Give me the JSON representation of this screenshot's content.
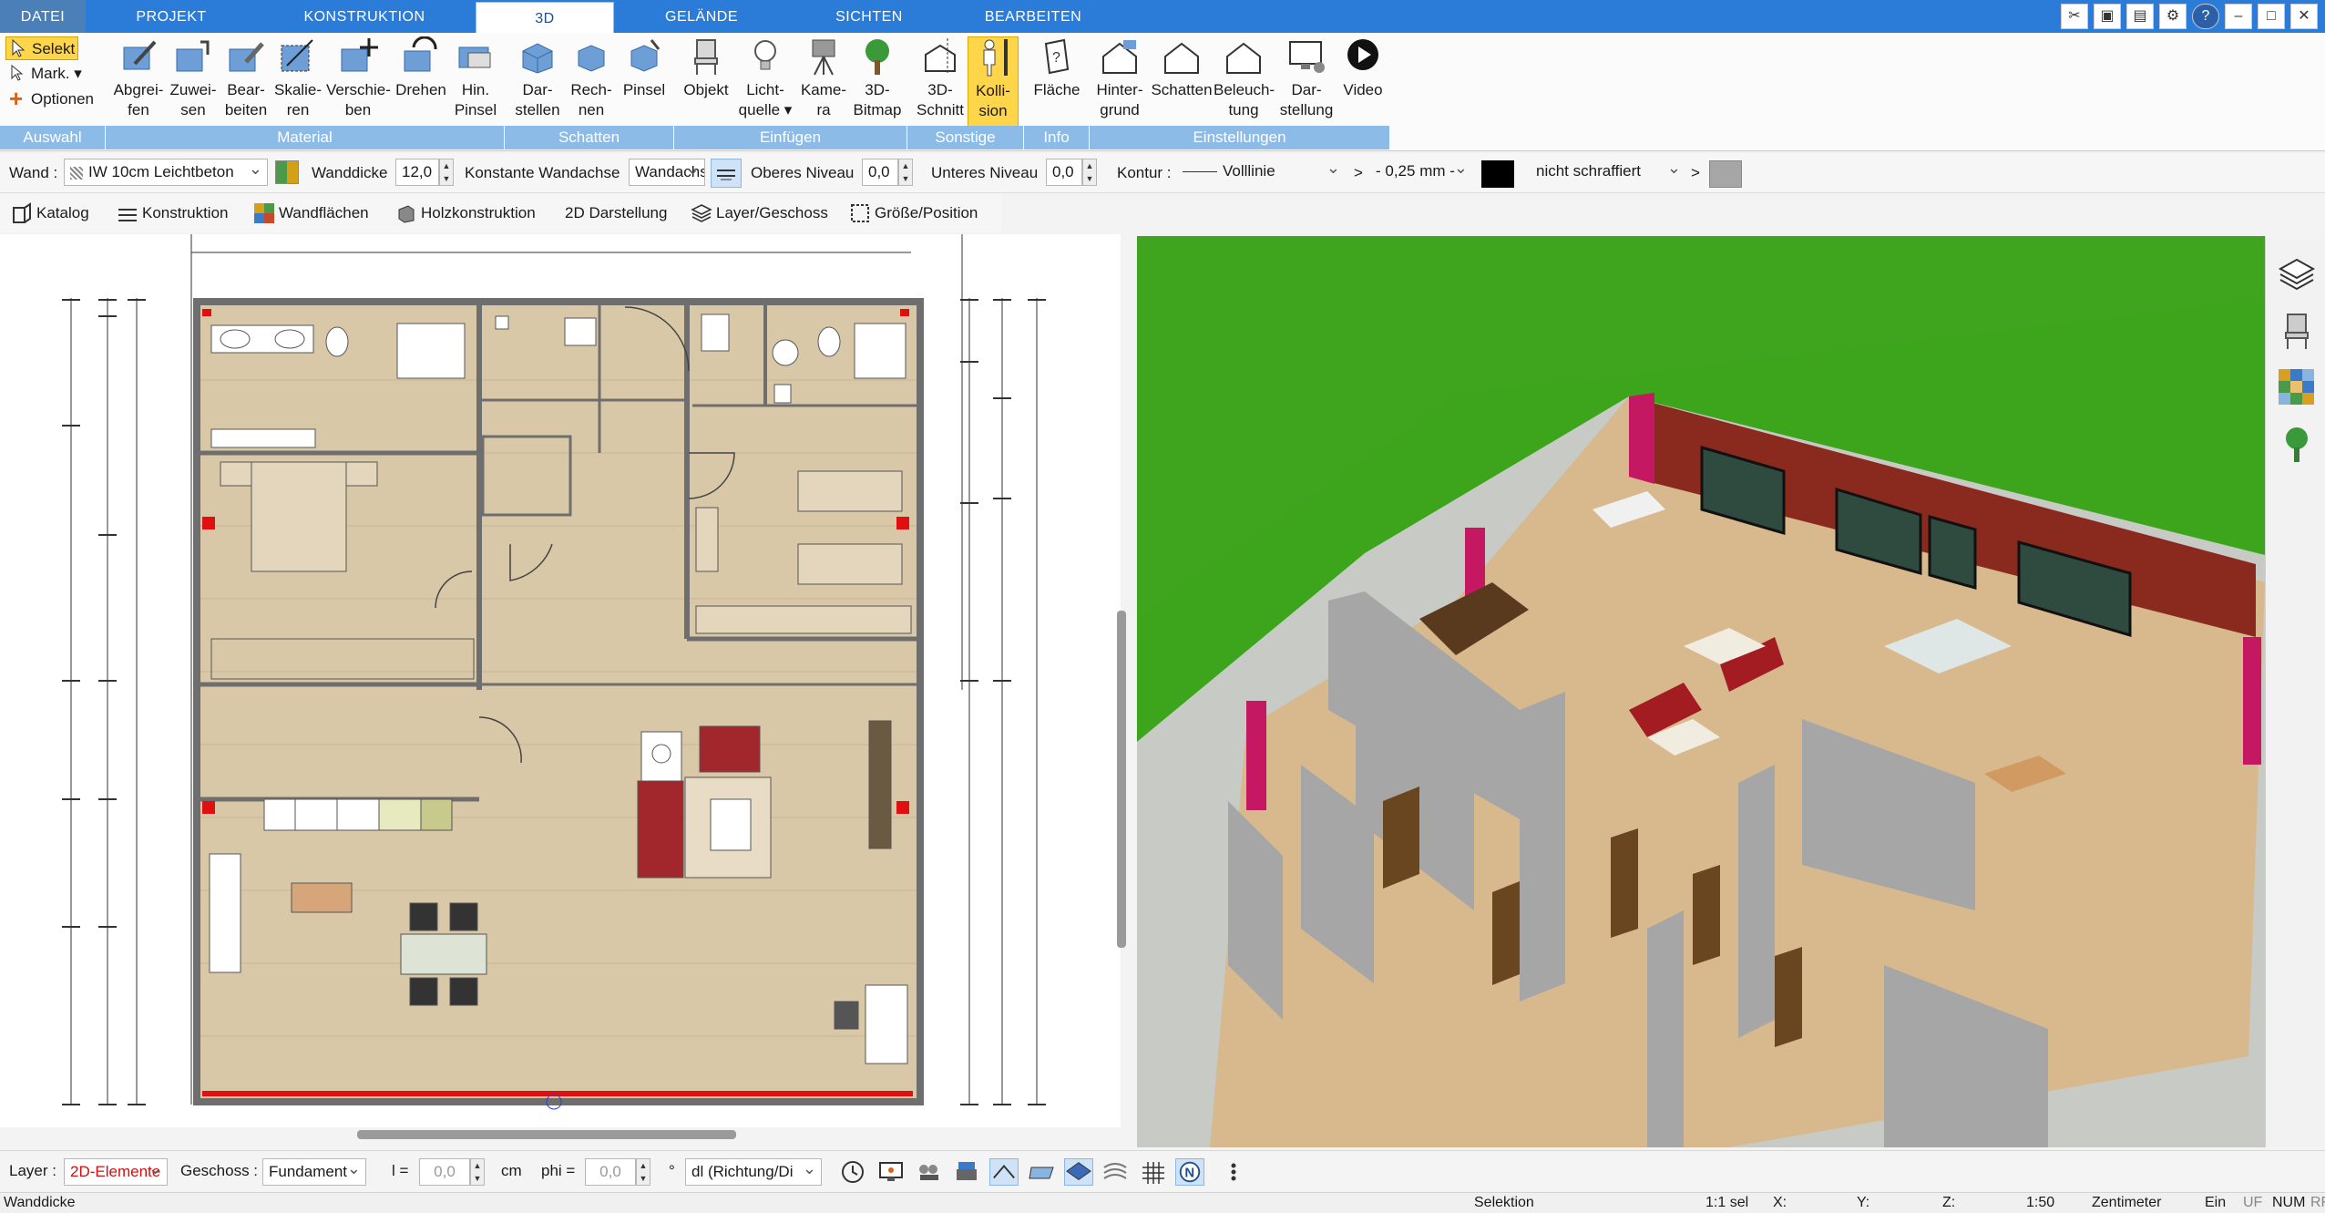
{
  "tabs": {
    "file": "DATEI",
    "items": [
      "PROJEKT",
      "KONSTRUKTION",
      "3D",
      "GELÄNDE",
      "SICHTEN",
      "BEARBEITEN"
    ]
  },
  "ribbon": {
    "selection": {
      "select": "Selekt",
      "mark": "Mark.",
      "options": "Optionen",
      "group": "Auswahl"
    },
    "material": {
      "group": "Material",
      "buttons": [
        {
          "l1": "Abgrei-",
          "l2": "fen",
          "icon": "pipette-icon"
        },
        {
          "l1": "Zuwei-",
          "l2": "sen",
          "icon": "assign-icon"
        },
        {
          "l1": "Bear-",
          "l2": "beiten",
          "icon": "edit-material-icon"
        },
        {
          "l1": "Skalie-",
          "l2": "ren",
          "icon": "scale-icon"
        },
        {
          "l1": "Verschie-",
          "l2": "ben",
          "icon": "move-icon"
        },
        {
          "l1": "Drehen",
          "l2": "",
          "icon": "rotate-icon"
        },
        {
          "l1": "Hin.",
          "l2": "Pinsel",
          "icon": "background-brush-icon"
        }
      ]
    },
    "schatten": {
      "group": "Schatten",
      "buttons": [
        {
          "l1": "Dar-",
          "l2": "stellen",
          "icon": "shadow-show-icon"
        },
        {
          "l1": "Rech-",
          "l2": "nen",
          "icon": "shadow-calc-icon"
        },
        {
          "l1": "Pinsel",
          "l2": "",
          "icon": "shadow-brush-icon"
        }
      ]
    },
    "einfuegen": {
      "group": "Einfügen",
      "buttons": [
        {
          "l1": "Objekt",
          "l2": "",
          "icon": "chair-icon"
        },
        {
          "l1": "Licht-",
          "l2": "quelle ▾",
          "icon": "lightbulb-icon"
        },
        {
          "l1": "Kame-",
          "l2": "ra",
          "icon": "camera-icon"
        },
        {
          "l1": "3D-",
          "l2": "Bitmap",
          "icon": "tree-icon"
        }
      ]
    },
    "sonstige": {
      "group": "Sonstige",
      "buttons": [
        {
          "l1": "3D-",
          "l2": "Schnitt",
          "icon": "section-icon"
        },
        {
          "l1": "Kolli-",
          "l2": "sion",
          "icon": "collision-icon"
        }
      ]
    },
    "info": {
      "group": "Info",
      "buttons": [
        {
          "l1": "Fläche",
          "l2": "",
          "icon": "area-icon"
        }
      ]
    },
    "einstellungen": {
      "group": "Einstellungen",
      "buttons": [
        {
          "l1": "Hinter-",
          "l2": "grund",
          "icon": "background-icon"
        },
        {
          "l1": "Schatten",
          "l2": "",
          "icon": "house-shadow-icon"
        },
        {
          "l1": "Beleuch-",
          "l2": "tung",
          "icon": "house-light-icon"
        },
        {
          "l1": "Dar-",
          "l2": "stellung",
          "icon": "display-icon"
        },
        {
          "l1": "Video",
          "l2": "",
          "icon": "play-icon"
        }
      ]
    }
  },
  "props": {
    "wall_label": "Wand :",
    "wall_type": "IW 10cm Leichtbeton",
    "thickness_label": "Wanddicke",
    "thickness": "12,0",
    "const_label": "Konstante Wandachse",
    "const_value": "Wandachse",
    "upper_label": "Oberes Niveau",
    "upper": "0,0",
    "lower_label": "Unteres Niveau",
    "lower": "0,0",
    "contour_label": "Kontur :",
    "line_style": "Volllinie",
    "gt1": ">",
    "width": "- 0,25 mm -",
    "hatch": "nicht schraffiert",
    "gt2": ">"
  },
  "subtoolbar": [
    "Katalog",
    "Konstruktion",
    "Wandflächen",
    "Holzkonstruktion",
    "2D Darstellung",
    "Layer/Geschoss",
    "Größe/Position"
  ],
  "bottom": {
    "layer_label": "Layer :",
    "layer": "2D-Elemente",
    "floor_label": "Geschoss :",
    "floor": "Fundament",
    "l_label": "l =",
    "l": "0,0",
    "cm": "cm",
    "phi_label": "phi =",
    "phi": "0,0",
    "deg": "°",
    "direction": "dl (Richtung/Di"
  },
  "status": {
    "left": "Wanddicke",
    "mode": "Selektion",
    "sel": "1:1 sel",
    "x": "X:",
    "y": "Y:",
    "z": "Z:",
    "scale": "1:50",
    "unit": "Zentimeter",
    "ein": "Ein",
    "uf": "UF",
    "num": "NUM",
    "rf": "RF"
  },
  "colors": {
    "tabbar": "#2b7bd8",
    "group_bar": "#8dbbe8",
    "active_toggle": "#ffd54a",
    "ground": "#3fa51f"
  }
}
